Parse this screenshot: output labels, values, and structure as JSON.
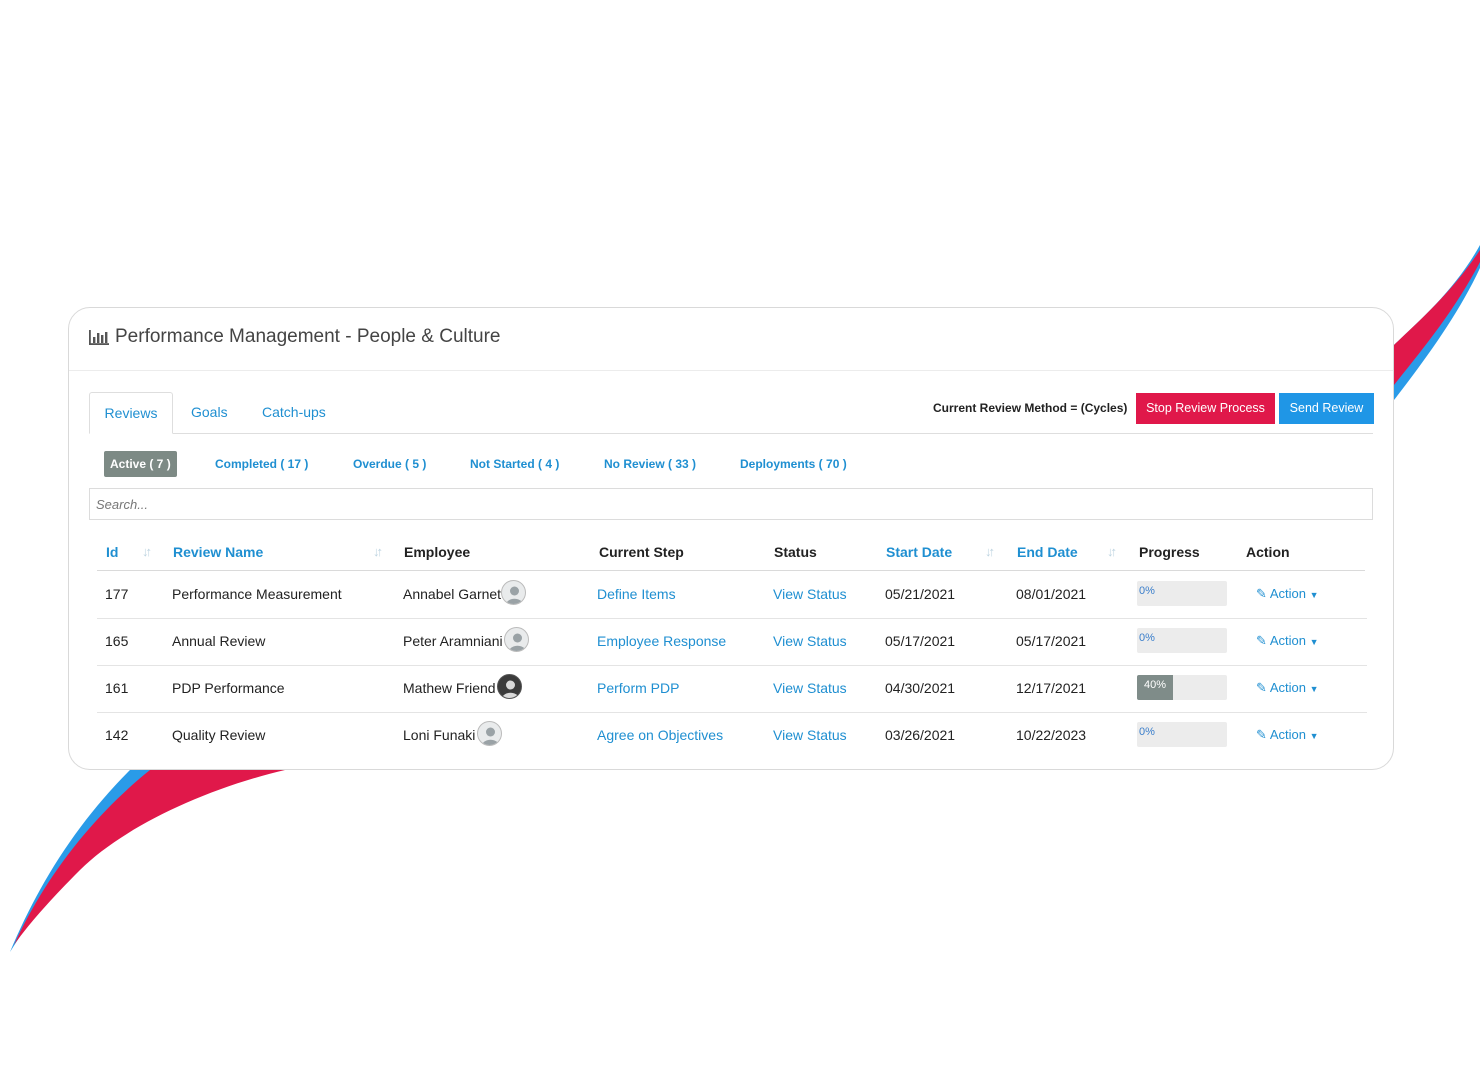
{
  "header": {
    "title": "Performance Management - People & Culture",
    "icon": "bar-chart-icon"
  },
  "tabs": [
    {
      "label": "Reviews",
      "active": true
    },
    {
      "label": "Goals",
      "active": false
    },
    {
      "label": "Catch-ups",
      "active": false
    }
  ],
  "review_method": "Current Review Method = (Cycles)",
  "buttons": {
    "stop": "Stop Review Process",
    "send": "Send Review"
  },
  "filters": [
    {
      "label": "Active ( 7 )",
      "active": true
    },
    {
      "label": "Completed ( 17 )",
      "active": false
    },
    {
      "label": "Overdue ( 5 )",
      "active": false
    },
    {
      "label": "Not Started ( 4 )",
      "active": false
    },
    {
      "label": "No Review ( 33 )",
      "active": false
    },
    {
      "label": "Deployments ( 70 )",
      "active": false
    }
  ],
  "search": {
    "placeholder": "Search..."
  },
  "columns": {
    "id": "Id",
    "review_name": "Review Name",
    "employee": "Employee",
    "current_step": "Current Step",
    "status": "Status",
    "start_date": "Start Date",
    "end_date": "End Date",
    "progress": "Progress",
    "action": "Action"
  },
  "rows": [
    {
      "id": "177",
      "review_name": "Performance Measurement",
      "employee": "Annabel Garnet",
      "current_step": "Define Items",
      "status": "View Status",
      "start_date": "05/21/2021",
      "end_date": "08/01/2021",
      "progress": 0,
      "progress_label": "0%",
      "action": "Action"
    },
    {
      "id": "165",
      "review_name": "Annual Review",
      "employee": "Peter Aramniani",
      "current_step": "Employee Response",
      "status": "View Status",
      "start_date": "05/17/2021",
      "end_date": "05/17/2021",
      "progress": 0,
      "progress_label": "0%",
      "action": "Action"
    },
    {
      "id": "161",
      "review_name": "PDP Performance",
      "employee": "Mathew Friend",
      "current_step": "Perform PDP",
      "status": "View Status",
      "start_date": "04/30/2021",
      "end_date": "12/17/2021",
      "progress": 40,
      "progress_label": "40%",
      "action": "Action"
    },
    {
      "id": "142",
      "review_name": "Quality Review",
      "employee": "Loni Funaki",
      "current_step": "Agree on Objectives",
      "status": "View Status",
      "start_date": "03/26/2021",
      "end_date": "10/22/2023",
      "progress": 0,
      "progress_label": "0%",
      "action": "Action"
    }
  ],
  "colors": {
    "accent": "#1f8fd1",
    "danger": "#e0184a",
    "primary": "#1f96e6",
    "muted": "#7d8a85"
  }
}
